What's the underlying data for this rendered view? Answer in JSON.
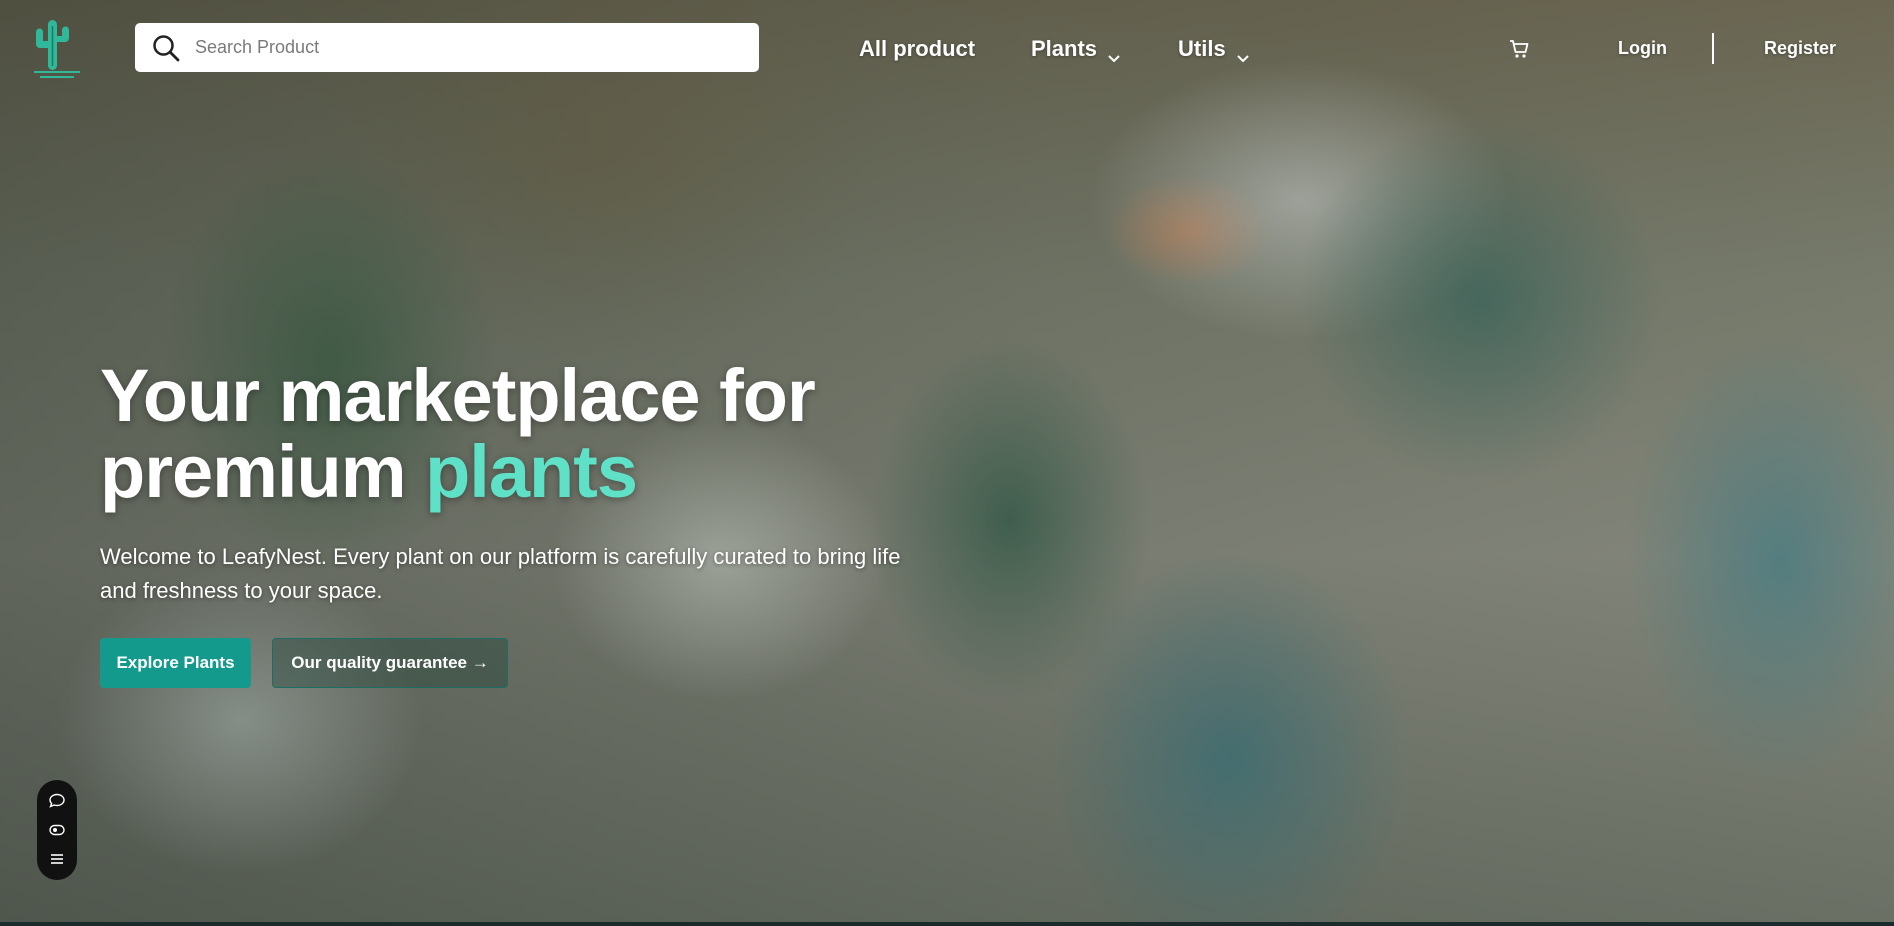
{
  "search": {
    "placeholder": "Search Product"
  },
  "nav": {
    "all_product": "All product",
    "plants": "Plants",
    "utils": "Utils"
  },
  "auth": {
    "login": "Login",
    "register": "Register"
  },
  "hero": {
    "headline_line1": "Your marketplace for",
    "headline_line2_prefix": "premium ",
    "headline_accent": "plants",
    "subtitle": "Welcome to LeafyNest. Every plant on our platform is carefully curated to bring life and freshness to your space.",
    "primary_button": "Explore Plants",
    "secondary_button": "Our quality guarantee →"
  },
  "colors": {
    "accent": "#5fe1c8",
    "primary_button": "#149a8c"
  },
  "icons": {
    "logo": "cactus-logo-icon",
    "search": "search-icon",
    "cart": "cart-icon",
    "chevron": "chevron-down-icon",
    "widget": [
      "chat-icon",
      "visibility-icon",
      "menu-icon"
    ]
  }
}
